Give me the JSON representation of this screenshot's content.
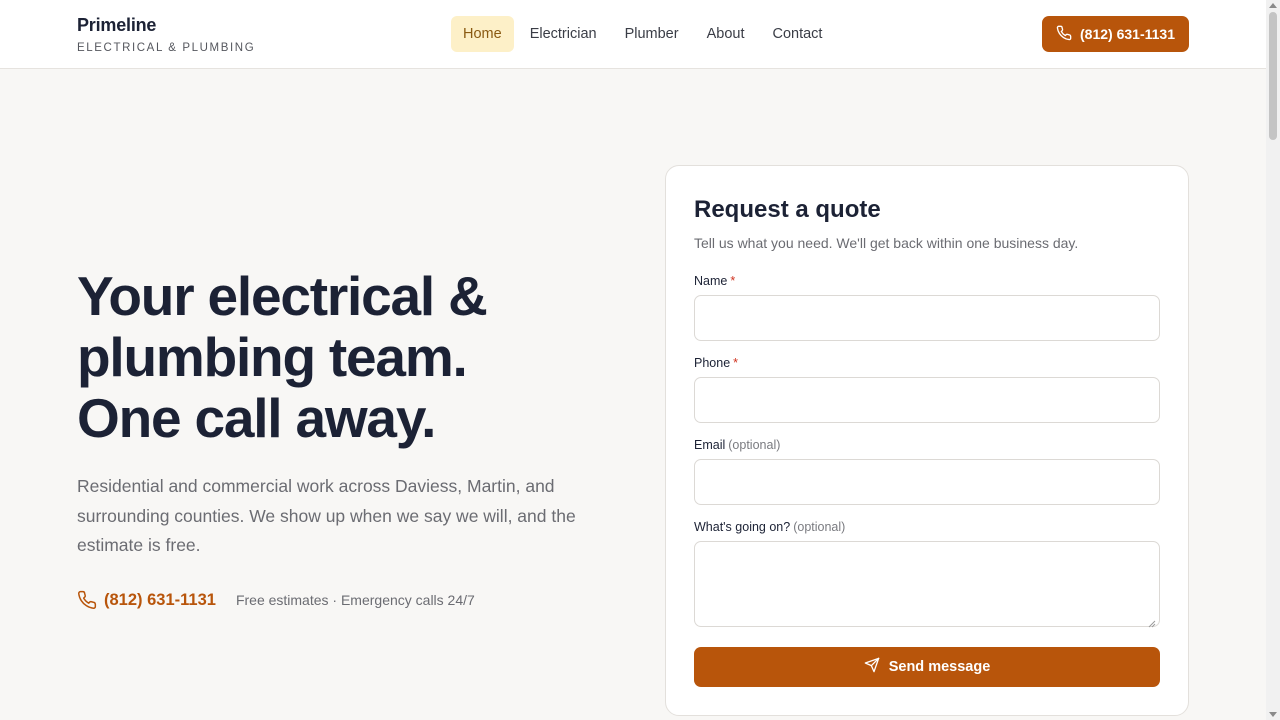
{
  "brand": {
    "name": "Primeline",
    "tagline": "ELECTRICAL & PLUMBING"
  },
  "nav": {
    "items": [
      {
        "label": "Home",
        "active": true
      },
      {
        "label": "Electrician",
        "active": false
      },
      {
        "label": "Plumber",
        "active": false
      },
      {
        "label": "About",
        "active": false
      },
      {
        "label": "Contact",
        "active": false
      }
    ]
  },
  "header": {
    "phone_label": "(812) 631-1131"
  },
  "hero": {
    "title_line1": "Your electrical &",
    "title_line2": "plumbing team.",
    "title_line3": "One call away.",
    "subtitle": "Residential and commercial work across Daviess, Martin, and surrounding counties. We show up when we say we will, and the estimate is free.",
    "phone": "(812) 631-1131",
    "note": "Free estimates · Emergency calls 24/7"
  },
  "form": {
    "title": "Request a quote",
    "subtitle": "Tell us what you need. We'll get back within one business day.",
    "fields": [
      {
        "label": "Name",
        "required": "*",
        "optional": "",
        "value": ""
      },
      {
        "label": "Phone",
        "required": "*",
        "optional": "",
        "value": ""
      },
      {
        "label": "Email",
        "required": "",
        "optional": "(optional)",
        "value": ""
      },
      {
        "label": "What's going on?",
        "required": "",
        "optional": "(optional)",
        "value": ""
      }
    ],
    "submit_label": "Send message"
  },
  "colors": {
    "accent": "#b8550b",
    "nav_active_bg": "#fdf0c8",
    "heading": "#1c2235",
    "page_bg": "#f8f7f5"
  },
  "icons": {
    "header_call": "phone-icon",
    "hero_call": "phone-icon",
    "submit": "send-icon"
  }
}
